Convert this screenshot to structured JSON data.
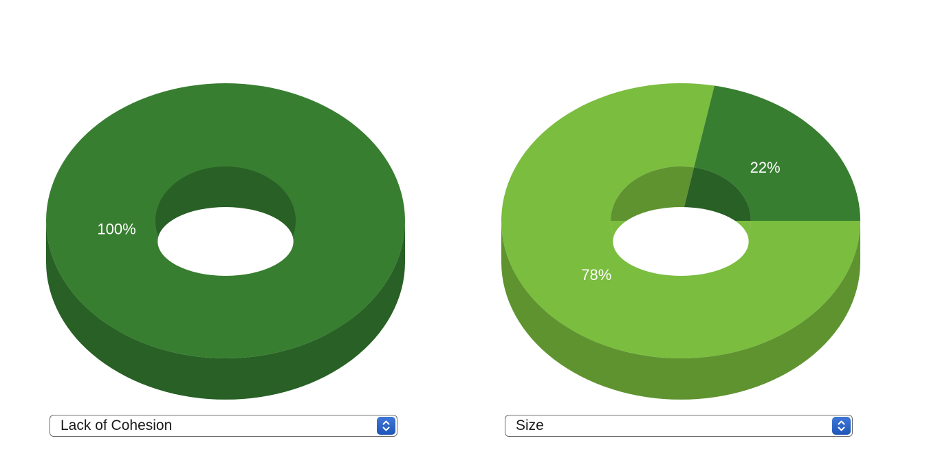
{
  "chart_data": [
    {
      "type": "pie",
      "style": "3d-donut",
      "slices": [
        {
          "value": 100,
          "label": "100%",
          "color": "#387e31",
          "side_color": "#286025"
        }
      ],
      "selector": {
        "selected": "Lack of Cohesion"
      }
    },
    {
      "type": "pie",
      "style": "3d-donut",
      "slices": [
        {
          "value": 78,
          "label": "78%",
          "color": "#7bbd3f",
          "side_color": "#5f9330"
        },
        {
          "value": 22,
          "label": "22%",
          "color": "#387e31",
          "side_color": "#286025"
        }
      ],
      "selector": {
        "selected": "Size"
      }
    }
  ],
  "colors": {
    "select_border": "#6b6b6b",
    "select_arrow_bg": "#2a62c6"
  }
}
